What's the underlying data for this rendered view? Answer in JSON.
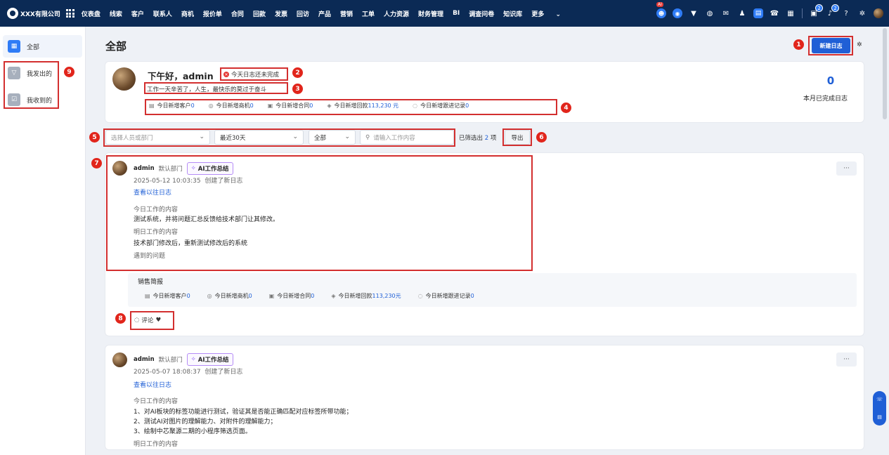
{
  "topbar": {
    "company": "XXX有限公司",
    "nav": [
      "仪表盘",
      "线索",
      "客户",
      "联系人",
      "商机",
      "报价单",
      "合同",
      "回款",
      "发票",
      "回访",
      "产品",
      "营销",
      "工单",
      "人力资源",
      "财务管理",
      "BI",
      "调查问卷",
      "知识库",
      "更多"
    ],
    "ai_badge": "AI",
    "badge_counts": [
      "2",
      "2"
    ]
  },
  "sidebar": {
    "items": [
      {
        "label": "全部"
      },
      {
        "label": "我发出的"
      },
      {
        "label": "我收到的"
      }
    ]
  },
  "header": {
    "title": "全部",
    "new_button": "新建日志"
  },
  "summary": {
    "greeting": "下午好，admin",
    "warning": "今天日志还未完成",
    "motto": "工作一天辛苦了，人生，最快乐的莫过于奋斗",
    "stats": [
      {
        "label": "今日新增客户",
        "value": "0"
      },
      {
        "label": "今日新增商机",
        "value": "0"
      },
      {
        "label": "今日新增合同",
        "value": "0"
      },
      {
        "label": "今日新增回款",
        "value": "113,230 元"
      },
      {
        "label": "今日新增跟进记录",
        "value": "0"
      }
    ],
    "done_count": "0",
    "done_label": "本月已完成日志"
  },
  "filters": {
    "person_placeholder": "选择人员或部门",
    "range": "最近30天",
    "scope": "全部",
    "search_placeholder": "请输入工作内容",
    "count_prefix": "已筛选出",
    "count": "2",
    "count_suffix": "项",
    "export": "导出"
  },
  "posts": [
    {
      "author": "admin",
      "dept": "默认部门",
      "ai_label": "AI工作总结",
      "time": "2025-05-12 10:03:35",
      "action": "创建了新日志",
      "history_link": "查看以往日志",
      "today_title": "今日工作的内容",
      "today_lines": [
        "测试系统，并将问题汇总反馈给技术部门让其修改。"
      ],
      "tomorrow_title": "明日工作的内容",
      "tomorrow_lines": [
        "技术部门修改后，重新测试修改后的系统"
      ],
      "problem_title": "遇到的问题",
      "more": "···",
      "sales_title": "销售简报",
      "sales_stats": [
        {
          "label": "今日新增客户",
          "value": "0"
        },
        {
          "label": "今日新增商机",
          "value": "0"
        },
        {
          "label": "今日新增合同",
          "value": "0"
        },
        {
          "label": "今日新增回款",
          "value": "113,230元"
        },
        {
          "label": "今日新增跟进记录",
          "value": "0"
        }
      ],
      "comment": "评论"
    },
    {
      "author": "admin",
      "dept": "默认部门",
      "ai_label": "AI工作总结",
      "time": "2025-05-07 18:08:37",
      "action": "创建了新日志",
      "history_link": "查看以往日志",
      "today_title": "今日工作的内容",
      "today_lines": [
        "1、对AI板块的标签功能进行测试，验证其是否能正确匹配对应标签所带功能；",
        "2、测试AI对图片的理解能力、对附件的理解能力；",
        "3、绘制中芯聚源二期的小程序筛选页面。"
      ],
      "tomorrow_title": "明日工作的内容",
      "more": "···"
    }
  ],
  "annotations": [
    "1",
    "2",
    "3",
    "4",
    "5",
    "6",
    "7",
    "8",
    "9"
  ],
  "colors": {
    "accent": "#1f5fd6",
    "topbar": "#0b2a55",
    "annotation": "#e1251b"
  }
}
